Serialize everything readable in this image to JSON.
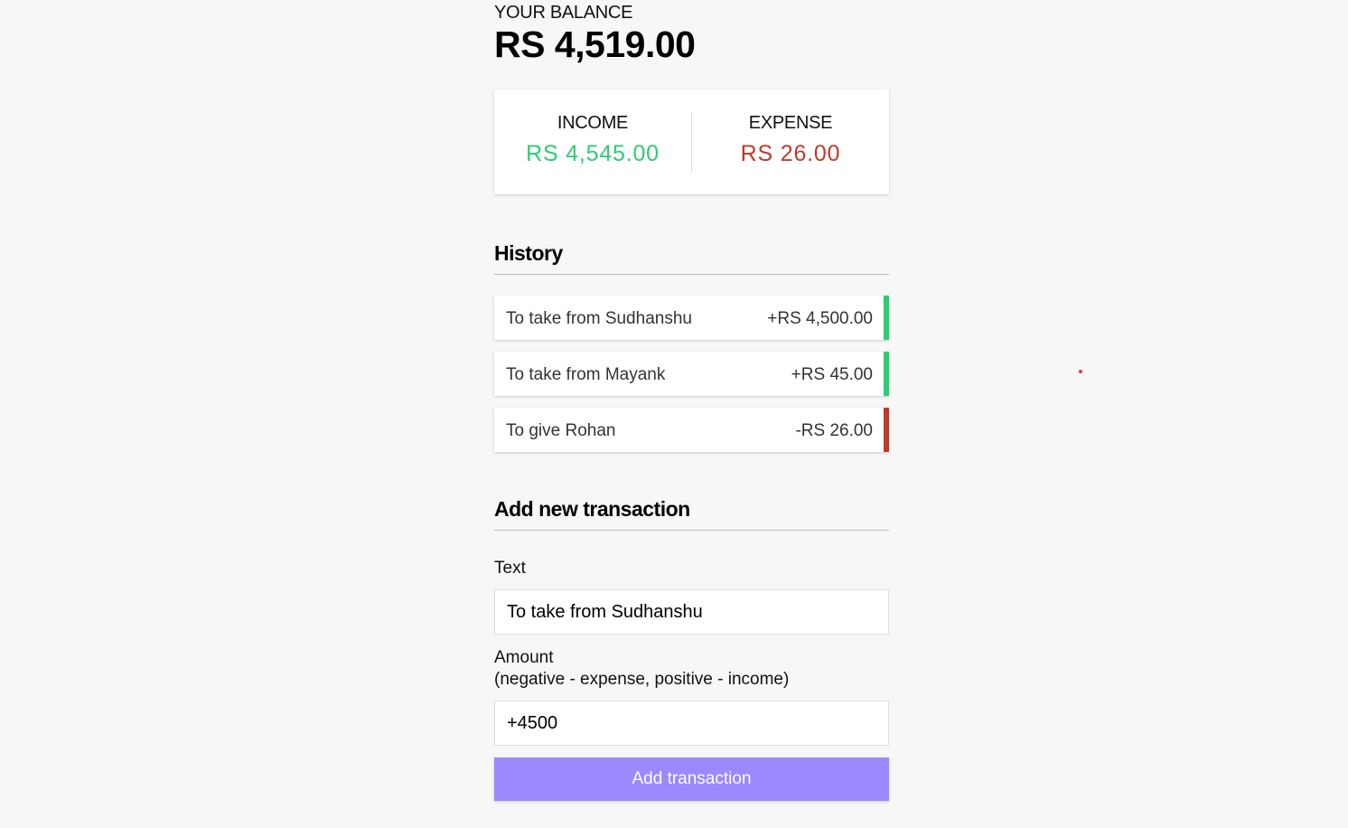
{
  "balance": {
    "label": "YOUR BALANCE",
    "value": "RS 4,519.00"
  },
  "summary": {
    "income_label": "INCOME",
    "income_value": "RS 4,545.00",
    "expense_label": "EXPENSE",
    "expense_value": "RS 26.00",
    "income_color": "#2ecc71",
    "expense_color": "#c0392b"
  },
  "history": {
    "title": "History",
    "items": [
      {
        "text": "To take from Sudhanshu",
        "amount": "+RS 4,500.00",
        "type": "income"
      },
      {
        "text": "To take from Mayank",
        "amount": "+RS 45.00",
        "type": "income"
      },
      {
        "text": "To give Rohan",
        "amount": "-RS 26.00",
        "type": "expense"
      }
    ]
  },
  "form": {
    "title": "Add new transaction",
    "text_label": "Text",
    "text_value": "To take from Sudhanshu",
    "amount_label": "Amount",
    "amount_hint": "(negative - expense, positive - income)",
    "amount_value": "+4500",
    "submit_label": "Add transaction",
    "button_color": "#9c88ff"
  }
}
